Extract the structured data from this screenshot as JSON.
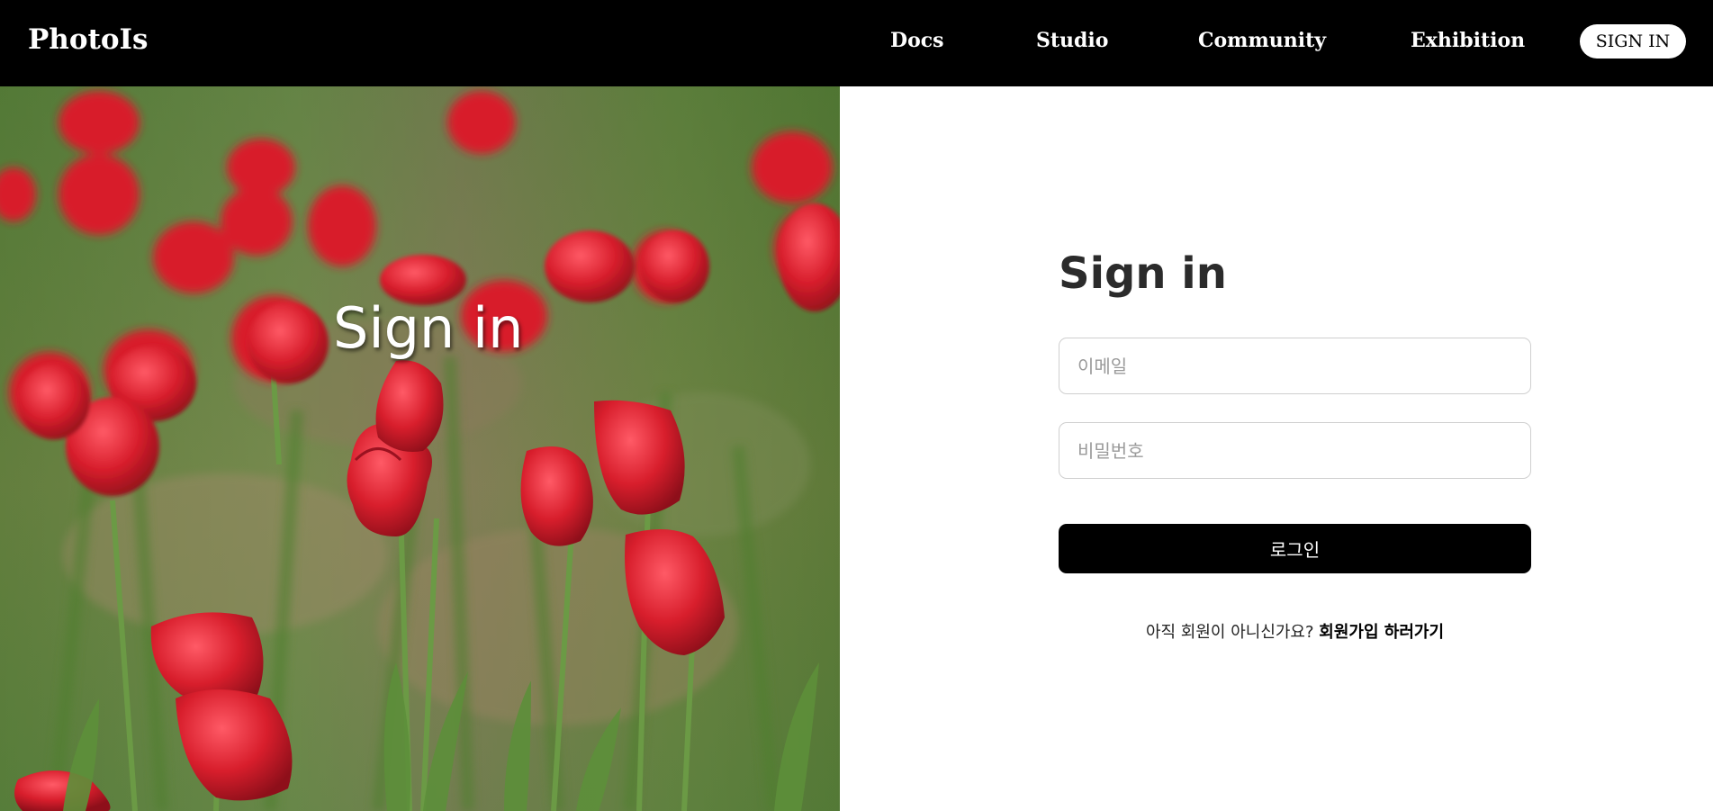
{
  "header": {
    "logo": "PhotoIs",
    "nav": {
      "docs": "Docs",
      "studio": "Studio",
      "community": "Community",
      "exhibition": "Exhibition"
    },
    "signin_button": "SIGN IN"
  },
  "hero": {
    "title": "Sign in",
    "image_subject": "red tulips field"
  },
  "form": {
    "title": "Sign in",
    "email_placeholder": "이메일",
    "password_placeholder": "비밀번호",
    "login_button": "로그인",
    "signup_prompt": "아직 회원이 아니신가요?",
    "signup_link": "회원가입 하러가기"
  },
  "colors": {
    "header_bg": "#000000",
    "accent_button": "#000000",
    "tulip_red": "#d81e2c",
    "stem_green": "#5f8a3e"
  }
}
